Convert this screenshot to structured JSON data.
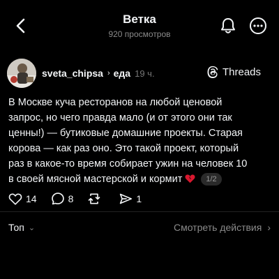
{
  "header": {
    "title": "Ветка",
    "subtitle": "920 просмотров",
    "back_icon": "chevron-left-icon",
    "bell_icon": "bell-icon",
    "more_icon": "more-icon"
  },
  "post": {
    "username": "sveta_chipsa",
    "topic_separator": "›",
    "topic": "еда",
    "time": "19 ч.",
    "threads_label": "Threads",
    "text_lines": [
      "В Москве куча ресторанов на любой ценовой",
      "запрос, но чего правда мало (и от этого они так",
      "ценны!) — бутиковые домашние проекты. Старая",
      "корова — как раз оно. Это такой проект, который",
      "раз в какое-то время собирает ужин на человек 10",
      "в своей мясной мастерской  и кормит"
    ],
    "emoji": "broken-heart-emoji",
    "counter": "1/2",
    "likes": "14",
    "comments": "8",
    "shares": "1"
  },
  "footer": {
    "sort_label": "Топ",
    "sort_chevron": "⌄",
    "view_actions": "Смотреть действия",
    "view_actions_arrow": "›"
  }
}
